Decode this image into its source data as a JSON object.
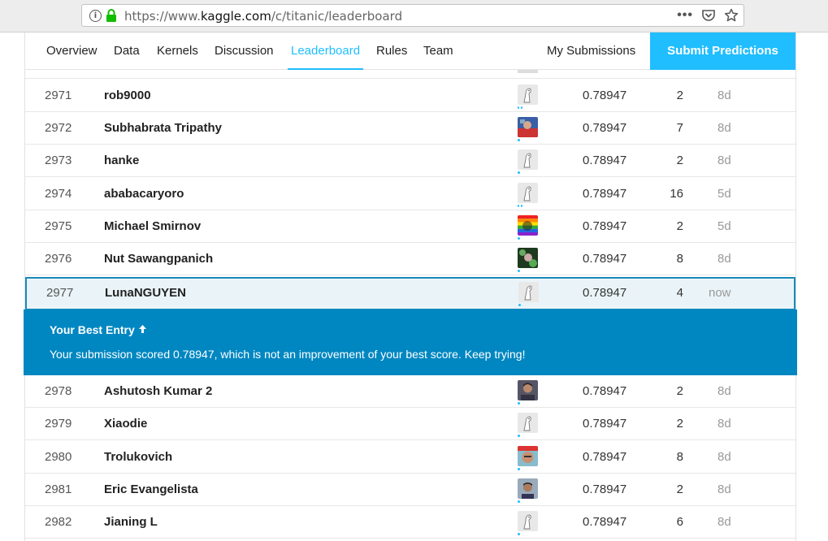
{
  "browser": {
    "url_prefix": "https://www.",
    "url_host": "kaggle.com",
    "url_path": "/c/titanic/leaderboard"
  },
  "nav": {
    "tabs": [
      {
        "label": "Overview"
      },
      {
        "label": "Data"
      },
      {
        "label": "Kernels"
      },
      {
        "label": "Discussion"
      },
      {
        "label": "Leaderboard"
      },
      {
        "label": "Rules"
      },
      {
        "label": "Team"
      }
    ],
    "my_submissions": "My Submissions",
    "submit_predictions": "Submit Predictions"
  },
  "colors": {
    "accent": "#20beff",
    "banner": "#0087c1",
    "highlight_border": "#1a8ab8"
  },
  "rows_before": [
    {
      "rank": "2971",
      "name": "rob9000",
      "avatar": "default",
      "score": "0.78947",
      "entries": "2",
      "last": "8d",
      "tier_dots": 2
    },
    {
      "rank": "2972",
      "name": "Subhabrata Tripathy",
      "avatar": "photo-blue",
      "score": "0.78947",
      "entries": "7",
      "last": "8d",
      "tier_dots": 1
    },
    {
      "rank": "2973",
      "name": "hanke",
      "avatar": "default",
      "score": "0.78947",
      "entries": "2",
      "last": "8d",
      "tier_dots": 1
    },
    {
      "rank": "2974",
      "name": "ababacaryoro",
      "avatar": "default",
      "score": "0.78947",
      "entries": "16",
      "last": "5d",
      "tier_dots": 2
    },
    {
      "rank": "2975",
      "name": "Michael Smirnov",
      "avatar": "photo-rainbow",
      "score": "0.78947",
      "entries": "2",
      "last": "5d",
      "tier_dots": 1
    },
    {
      "rank": "2976",
      "name": "Nut Sawangpanich",
      "avatar": "photo-dark",
      "score": "0.78947",
      "entries": "8",
      "last": "8d",
      "tier_dots": 1
    }
  ],
  "current_row": {
    "rank": "2977",
    "name": "LunaNGUYEN",
    "avatar": "default",
    "score": "0.78947",
    "entries": "4",
    "last": "now",
    "tier_dots": 1
  },
  "banner": {
    "title": "Your Best Entry",
    "message": "Your submission scored 0.78947, which is not an improvement of your best score. Keep trying!"
  },
  "rows_after": [
    {
      "rank": "2978",
      "name": "Ashutosh Kumar 2",
      "avatar": "photo-man",
      "score": "0.78947",
      "entries": "2",
      "last": "8d",
      "tier_dots": 1
    },
    {
      "rank": "2979",
      "name": "Xiaodie",
      "avatar": "default",
      "score": "0.78947",
      "entries": "2",
      "last": "8d",
      "tier_dots": 1
    },
    {
      "rank": "2980",
      "name": "Trolukovich",
      "avatar": "photo-cap",
      "score": "0.78947",
      "entries": "8",
      "last": "8d",
      "tier_dots": 1
    },
    {
      "rank": "2981",
      "name": "Eric Evangelista",
      "avatar": "photo-man2",
      "score": "0.78947",
      "entries": "2",
      "last": "8d",
      "tier_dots": 1
    },
    {
      "rank": "2982",
      "name": "Jianing L",
      "avatar": "default",
      "score": "0.78947",
      "entries": "6",
      "last": "8d",
      "tier_dots": 1
    }
  ]
}
